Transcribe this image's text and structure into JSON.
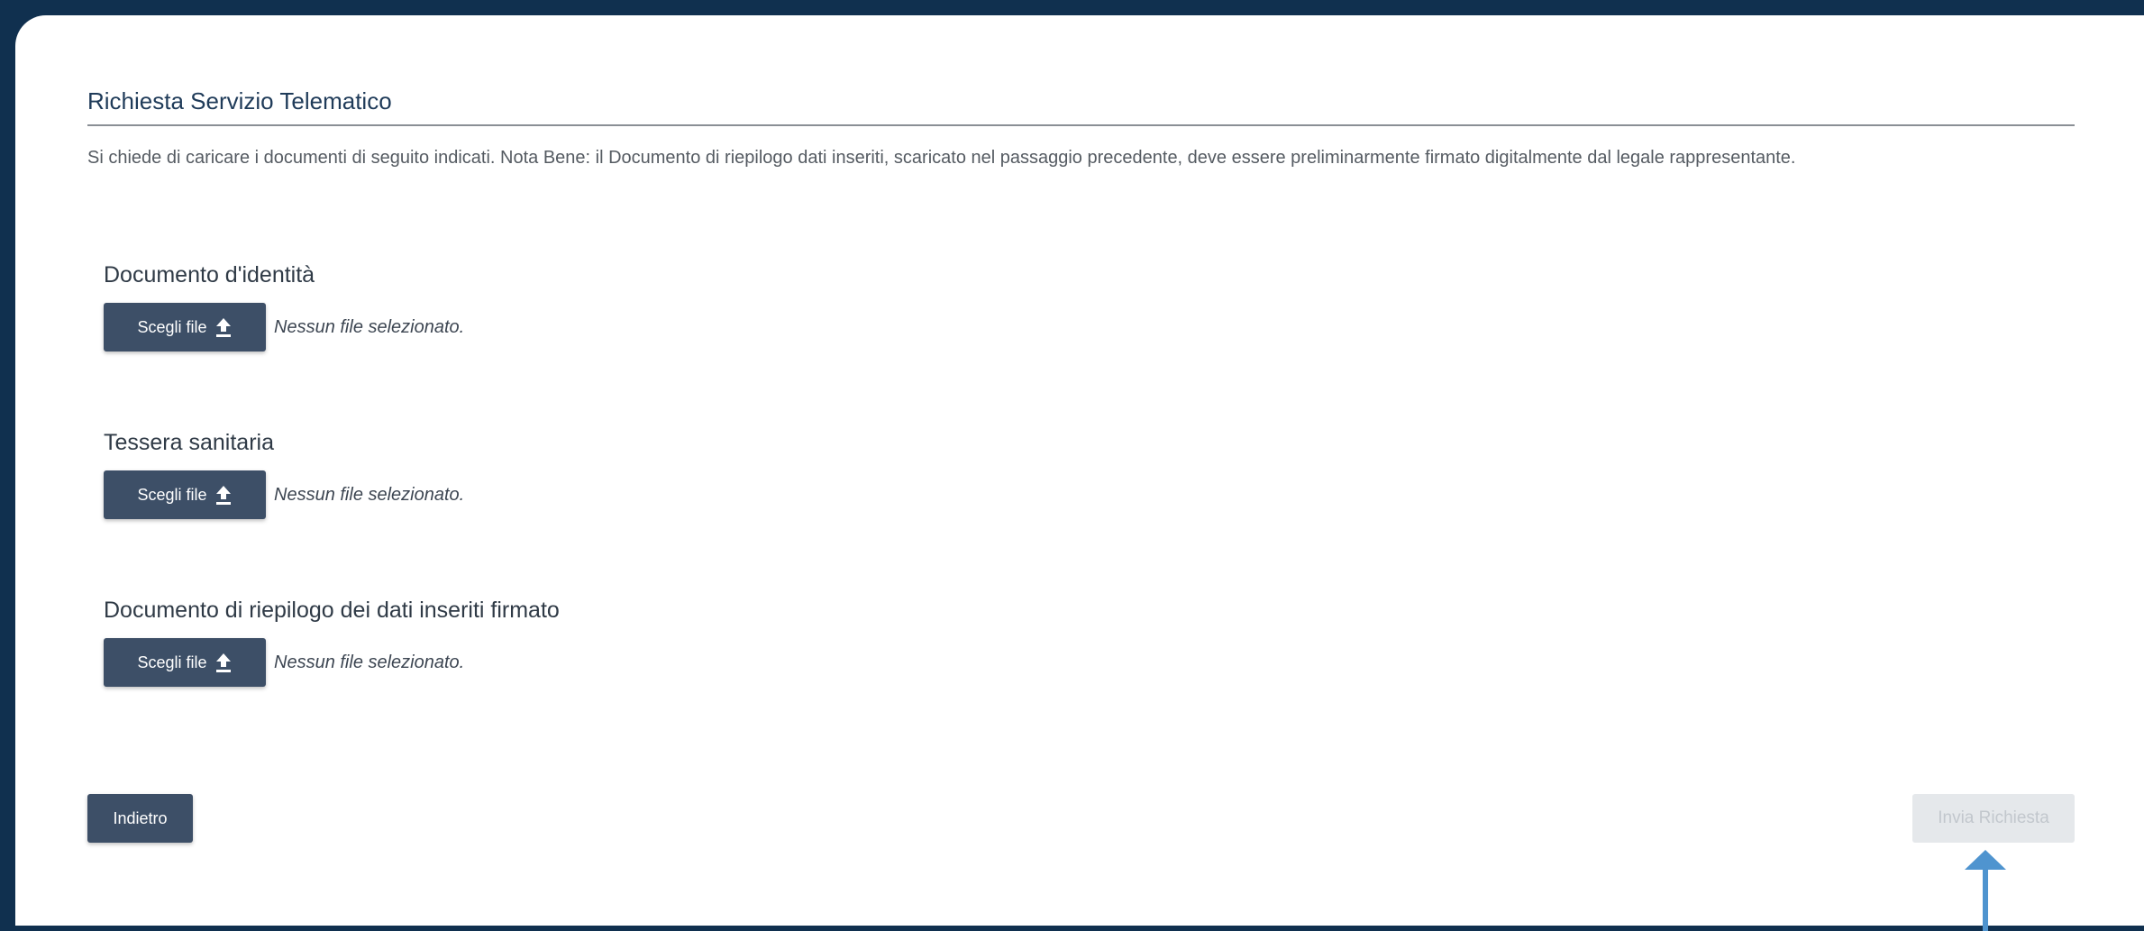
{
  "section": {
    "title": "Richiesta Servizio Telematico",
    "intro": "Si chiede di caricare i documenti di seguito indicati. Nota Bene: il Documento di riepilogo dati inseriti, scaricato nel passaggio precedente, deve essere preliminarmente firmato digitalmente dal legale rappresentante."
  },
  "uploads": [
    {
      "label": "Documento d'identità",
      "button_label": "Scegli file",
      "status": "Nessun file selezionato."
    },
    {
      "label": "Tessera sanitaria",
      "button_label": "Scegli file",
      "status": "Nessun file selezionato."
    },
    {
      "label": "Documento di riepilogo dei dati inseriti firmato",
      "button_label": "Scegli file",
      "status": "Nessun file selezionato."
    }
  ],
  "actions": {
    "back_label": "Indietro",
    "submit_label": "Invia Richiesta",
    "submit_disabled": true
  },
  "icons": {
    "upload": "upload-icon",
    "annotation_arrow": "arrow-up-icon"
  },
  "colors": {
    "background": "#10304f",
    "button": "#3d4f67",
    "disabled_button": "#e5e8eb",
    "arrow": "#4f94cf"
  }
}
